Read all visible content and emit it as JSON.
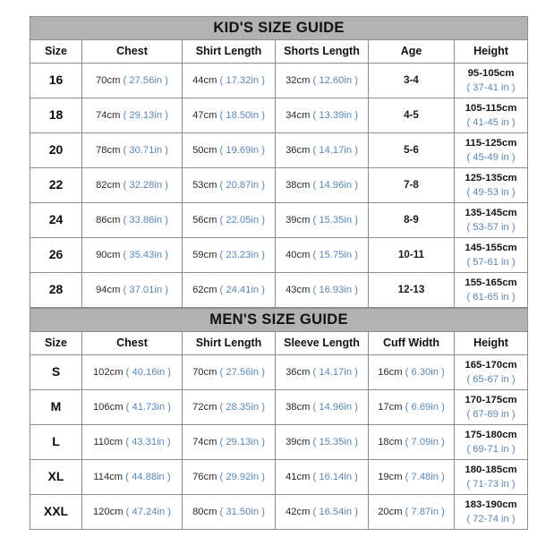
{
  "kids": {
    "title": "KID'S SIZE GUIDE",
    "columns": [
      "Size",
      "Chest",
      "Shirt Length",
      "Shorts Length",
      "Age",
      "Height"
    ],
    "rows": [
      {
        "size": "16",
        "chest_cm": "70cm",
        "chest_in": "( 27.56in )",
        "shirt_cm": "44cm",
        "shirt_in": "( 17.32in )",
        "shorts_cm": "32cm",
        "shorts_in": "( 12.60in )",
        "age": "3-4",
        "height_cm": "95-105cm",
        "height_in": "( 37-41 in )"
      },
      {
        "size": "18",
        "chest_cm": "74cm",
        "chest_in": "( 29.13in )",
        "shirt_cm": "47cm",
        "shirt_in": "( 18.50in )",
        "shorts_cm": "34cm",
        "shorts_in": "( 13.39in )",
        "age": "4-5",
        "height_cm": "105-115cm",
        "height_in": "( 41-45 in )"
      },
      {
        "size": "20",
        "chest_cm": "78cm",
        "chest_in": "( 30.71in )",
        "shirt_cm": "50cm",
        "shirt_in": "( 19.69in )",
        "shorts_cm": "36cm",
        "shorts_in": "( 14.17in )",
        "age": "5-6",
        "height_cm": "115-125cm",
        "height_in": "( 45-49 in )"
      },
      {
        "size": "22",
        "chest_cm": "82cm",
        "chest_in": "( 32.28in )",
        "shirt_cm": "53cm",
        "shirt_in": "( 20.87in )",
        "shorts_cm": "38cm",
        "shorts_in": "( 14.96in )",
        "age": "7-8",
        "height_cm": "125-135cm",
        "height_in": "( 49-53 in )"
      },
      {
        "size": "24",
        "chest_cm": "86cm",
        "chest_in": "( 33.86in )",
        "shirt_cm": "56cm",
        "shirt_in": "( 22.05in )",
        "shorts_cm": "39cm",
        "shorts_in": "( 15.35in )",
        "age": "8-9",
        "height_cm": "135-145cm",
        "height_in": "( 53-57 in )"
      },
      {
        "size": "26",
        "chest_cm": "90cm",
        "chest_in": "( 35.43in )",
        "shirt_cm": "59cm",
        "shirt_in": "( 23.23in )",
        "shorts_cm": "40cm",
        "shorts_in": "( 15.75in )",
        "age": "10-11",
        "height_cm": "145-155cm",
        "height_in": "( 57-61 in )"
      },
      {
        "size": "28",
        "chest_cm": "94cm",
        "chest_in": "( 37.01in )",
        "shirt_cm": "62cm",
        "shirt_in": "( 24.41in )",
        "shorts_cm": "43cm",
        "shorts_in": "( 16.93in )",
        "age": "12-13",
        "height_cm": "155-165cm",
        "height_in": "( 61-65 in )"
      }
    ]
  },
  "mens": {
    "title": "MEN'S SIZE GUIDE",
    "columns": [
      "Size",
      "Chest",
      "Shirt Length",
      "Sleeve Length",
      "Cuff Width",
      "Height"
    ],
    "rows": [
      {
        "size": "S",
        "chest_cm": "102cm",
        "chest_in": "( 40.16in )",
        "shirt_cm": "70cm",
        "shirt_in": "( 27.56in )",
        "sleeve_cm": "36cm",
        "sleeve_in": "( 14.17in )",
        "cuff_cm": "16cm",
        "cuff_in": "( 6.30in )",
        "height_cm": "165-170cm",
        "height_in": "( 65-67 in )"
      },
      {
        "size": "M",
        "chest_cm": "106cm",
        "chest_in": "( 41.73in )",
        "shirt_cm": "72cm",
        "shirt_in": "( 28.35in )",
        "sleeve_cm": "38cm",
        "sleeve_in": "( 14.96in )",
        "cuff_cm": "17cm",
        "cuff_in": "( 6.69in )",
        "height_cm": "170-175cm",
        "height_in": "( 67-69 in )"
      },
      {
        "size": "L",
        "chest_cm": "110cm",
        "chest_in": "( 43.31in )",
        "shirt_cm": "74cm",
        "shirt_in": "( 29.13in )",
        "sleeve_cm": "39cm",
        "sleeve_in": "( 15.35in )",
        "cuff_cm": "18cm",
        "cuff_in": "( 7.09in )",
        "height_cm": "175-180cm",
        "height_in": "( 69-71 in )"
      },
      {
        "size": "XL",
        "chest_cm": "114cm",
        "chest_in": "( 44.88in )",
        "shirt_cm": "76cm",
        "shirt_in": "( 29.92in )",
        "sleeve_cm": "41cm",
        "sleeve_in": "( 16.14in )",
        "cuff_cm": "19cm",
        "cuff_in": "( 7.48in )",
        "height_cm": "180-185cm",
        "height_in": "( 71-73 in )"
      },
      {
        "size": "XXL",
        "chest_cm": "120cm",
        "chest_in": "( 47.24in )",
        "shirt_cm": "80cm",
        "shirt_in": "( 31.50in )",
        "sleeve_cm": "42cm",
        "sleeve_in": "( 16.54in )",
        "cuff_cm": "20cm",
        "cuff_in": "( 7.87in )",
        "height_cm": "183-190cm",
        "height_in": "( 72-74 in )"
      }
    ]
  },
  "colors": {
    "banner_bg": "#b2b2b2",
    "border": "#8d8d8d",
    "inch_text": "#5b86b5",
    "cm_text": "#2b2b2b"
  }
}
